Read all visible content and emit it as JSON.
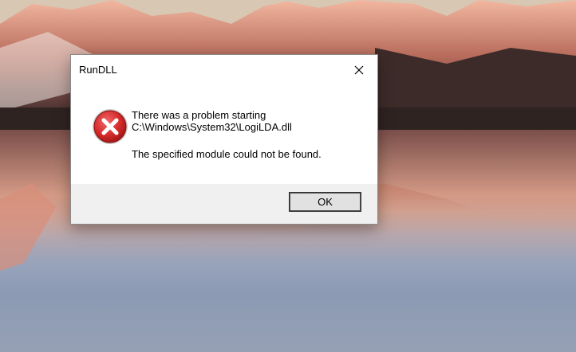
{
  "dialog": {
    "title": "RunDLL",
    "message_line1": "There was a problem starting",
    "message_line2": "C:\\Windows\\System32\\LogiLDA.dll",
    "detail": "The specified module could not be found.",
    "ok_label": "OK",
    "icon": "error-icon",
    "close_icon": "close-icon"
  },
  "colors": {
    "dialog_background": "#ffffff",
    "footer_background": "#f0f0f0",
    "error_red": "#d42a2a",
    "button_background": "#e1e1e1"
  }
}
